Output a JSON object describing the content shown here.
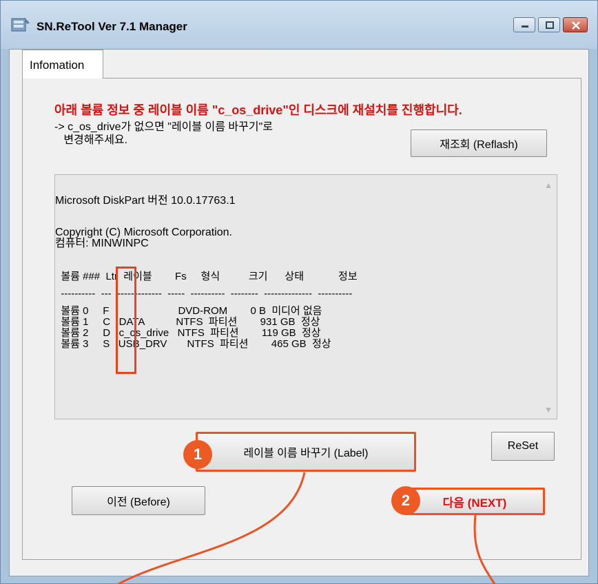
{
  "window": {
    "title": "SN.ReTool Ver 7.1  Manager",
    "app_icon": "app-icon"
  },
  "tab": {
    "label": "Infomation"
  },
  "message": {
    "warning": "아래 볼륨 정보 중 레이블 이름 \"c_os_drive\"인 디스크에 재설치를 진행합니다.",
    "note_line1": "-> c_os_drive가 없으면 \"레이블 이름 바꾸기\"로",
    "note_line2": "   변경해주세요."
  },
  "buttons": {
    "refresh": "재조회 (Reflash)",
    "label": "레이블 이름 바꾸기 (Label)",
    "reset": "ReSet",
    "before": "이전 (Before)",
    "next": "다음 (NEXT)"
  },
  "console": {
    "line1": "Microsoft DiskPart 버전 10.0.17763.1",
    "line2": "Copyright (C) Microsoft Corporation.",
    "line3": "컴퓨터: MINWINPC",
    "header": "  볼륨 ###  Ltr  레이블        Fs     형식          크기      상태            정보",
    "divider": "  ----------  ---  -------------  -----  ----------  --------  --------------  ----------",
    "rows": [
      "  볼륨 0     F                        DVD-ROM        0 B  미디어 없음",
      "  볼륨 1     C   DATA           NTFS  파티션        931 GB  정상",
      "  볼륨 2     D   c_os_drive   NTFS  파티션        119 GB  정상",
      "  볼륨 3     S   USB_DRV       NTFS  파티션        465 GB  정상"
    ]
  },
  "badges": {
    "one": "1",
    "two": "2"
  },
  "colors": {
    "accent": "#ee5a24",
    "warning_text": "#e01010",
    "title_bar": "#cfe0f0"
  }
}
